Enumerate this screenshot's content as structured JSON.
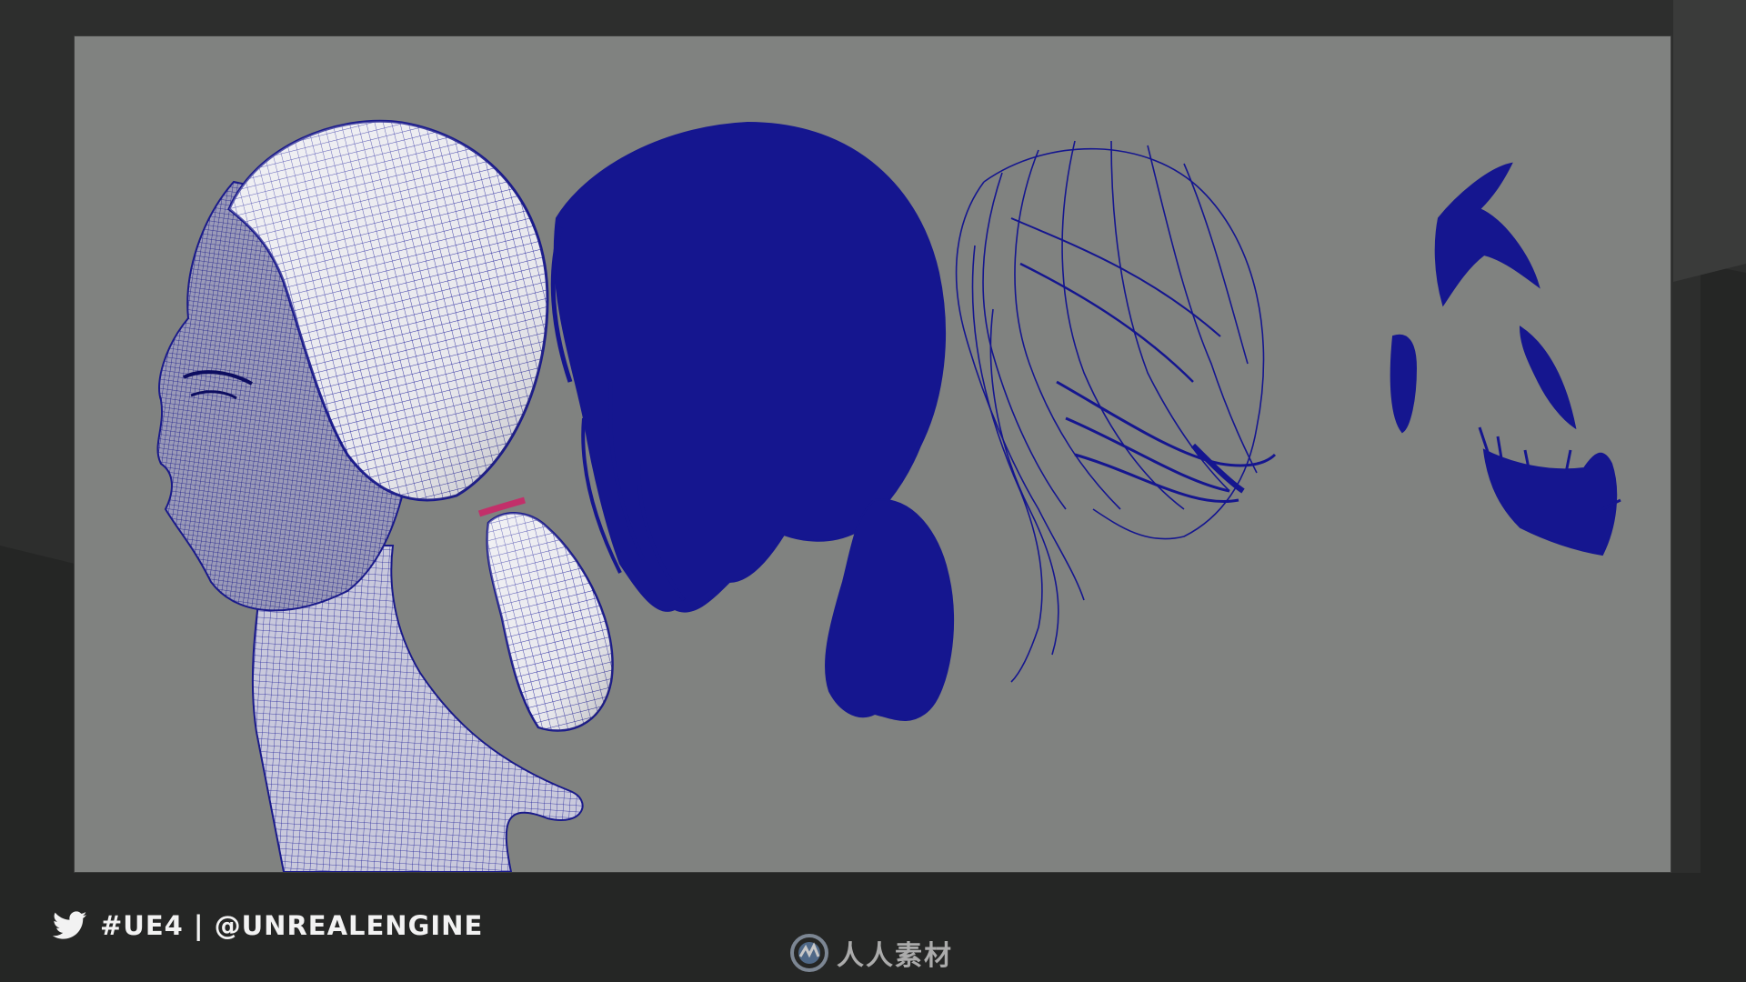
{
  "footer": {
    "hashtag_text": "#UE4 | @UNREALENGINE",
    "icon": "twitter-bird-icon"
  },
  "watermark": {
    "text": "人人素材",
    "icon": "watermark-logo-icon"
  },
  "slide": {
    "panels": [
      {
        "name": "head-wireframe",
        "icon": "wireframe-head-mesh"
      },
      {
        "name": "hair-dense",
        "icon": "dense-hair-strands"
      },
      {
        "name": "hair-sparse",
        "icon": "sparse-hair-strands"
      },
      {
        "name": "eyebrows-lashes",
        "icon": "eyebrow-eyelash-strands"
      }
    ]
  },
  "colors": {
    "background": "#2d2e2d",
    "slide_bg": "#808280",
    "strand_blue": "#15168f",
    "footer_text": "#f2f2f2",
    "mesh_white": "#e8e8ea"
  }
}
